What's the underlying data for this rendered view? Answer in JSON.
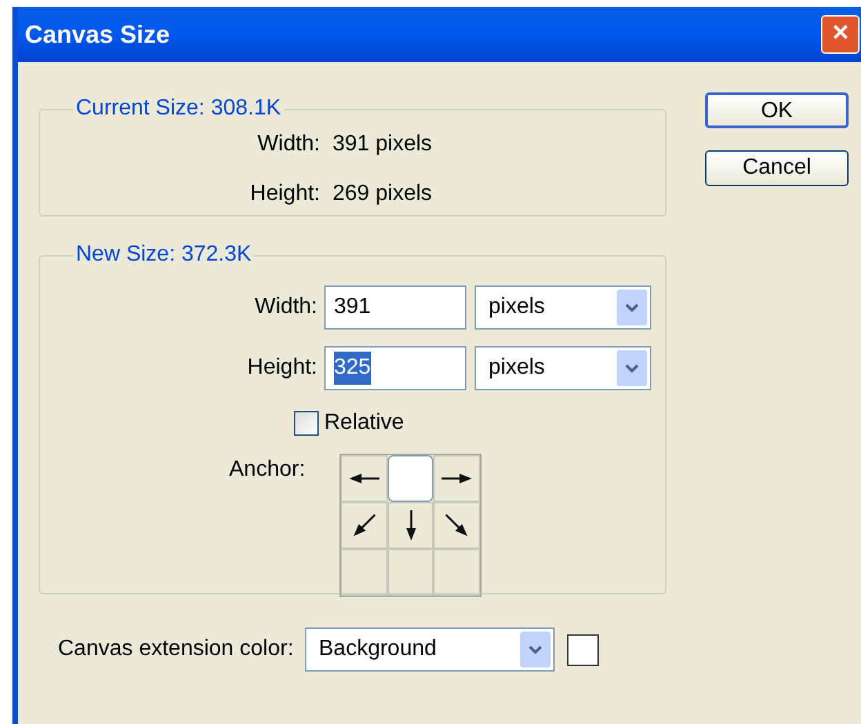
{
  "window": {
    "title": "Canvas Size",
    "close": "✕"
  },
  "current_size": {
    "legend": "Current Size: 308.1K",
    "rows": [
      {
        "label": "Width:",
        "value": "391 pixels"
      },
      {
        "label": "Height:",
        "value": "269 pixels"
      }
    ]
  },
  "new_size": {
    "legend": "New Size: 372.3K",
    "rows": [
      {
        "label": "Width:",
        "value": "391",
        "text_selected": false,
        "unit": "pixels"
      },
      {
        "label": "Height:",
        "value": "325",
        "text_selected": true,
        "unit": "pixels"
      }
    ],
    "relative": {
      "label": "Relative",
      "checked": false
    },
    "anchor": {
      "label": "Anchor:",
      "cells": [
        {
          "kind": "left",
          "selected": false
        },
        {
          "kind": "none",
          "selected": true
        },
        {
          "kind": "right",
          "selected": false
        },
        {
          "kind": "down-left",
          "selected": false
        },
        {
          "kind": "down",
          "selected": false
        },
        {
          "kind": "down-right",
          "selected": false
        },
        {
          "kind": "none",
          "selected": false
        },
        {
          "kind": "none",
          "selected": false
        },
        {
          "kind": "none",
          "selected": false
        }
      ]
    }
  },
  "extension_color": {
    "label": "Canvas extension color:",
    "value": "Background",
    "color": "#ffffff"
  },
  "buttons": [
    "OK",
    "Cancel"
  ]
}
